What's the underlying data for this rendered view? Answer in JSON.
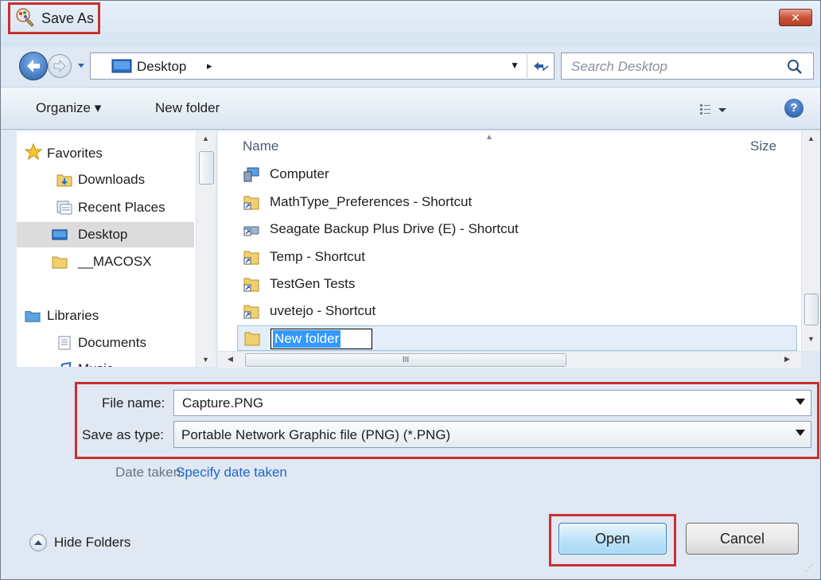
{
  "window": {
    "title": "Save As",
    "close_label": "✕"
  },
  "address": {
    "location": "Desktop",
    "chevron": "▸"
  },
  "search": {
    "placeholder": "Search Desktop"
  },
  "toolbar": {
    "organize": "Organize ▾",
    "new_folder": "New folder",
    "help": "?"
  },
  "nav": {
    "favorites_header": "Favorites",
    "favorites": [
      {
        "label": "Downloads",
        "icon": "downloads-folder-icon"
      },
      {
        "label": "Recent Places",
        "icon": "recent-places-icon"
      },
      {
        "label": "Desktop",
        "icon": "desktop-icon",
        "selected": true
      },
      {
        "label": "__MACOSX",
        "icon": "folder-icon"
      }
    ],
    "libraries_header": "Libraries",
    "libraries": [
      {
        "label": "Documents",
        "icon": "documents-icon"
      },
      {
        "label": "Music",
        "icon": "music-icon"
      }
    ]
  },
  "filelist": {
    "columns": {
      "name": "Name",
      "size": "Size"
    },
    "items": [
      {
        "name": "Computer",
        "icon": "computer-icon"
      },
      {
        "name": "MathType_Preferences - Shortcut",
        "icon": "shortcut-folder-icon"
      },
      {
        "name": "Seagate Backup Plus Drive (E) - Shortcut",
        "icon": "shortcut-drive-icon"
      },
      {
        "name": "Temp - Shortcut",
        "icon": "shortcut-folder-icon"
      },
      {
        "name": "TestGen Tests",
        "icon": "shortcut-folder-icon"
      },
      {
        "name": "uvetejo - Shortcut",
        "icon": "shortcut-folder-icon"
      }
    ],
    "editing_item": "New folder",
    "hscroll_grip": "III"
  },
  "form": {
    "file_name_label": "File name:",
    "file_name_value": "Capture.PNG",
    "save_type_label": "Save as type:",
    "save_type_value": "Portable Network Graphic file (PNG) (*.PNG)",
    "date_taken_label": "Date taken:",
    "date_taken_link": "Specify date taken"
  },
  "footer": {
    "hide_folders": "Hide Folders",
    "open": "Open",
    "cancel": "Cancel"
  },
  "colors": {
    "highlight": "#c8302f",
    "link": "#1f66c9",
    "selection": "#3399ff"
  }
}
